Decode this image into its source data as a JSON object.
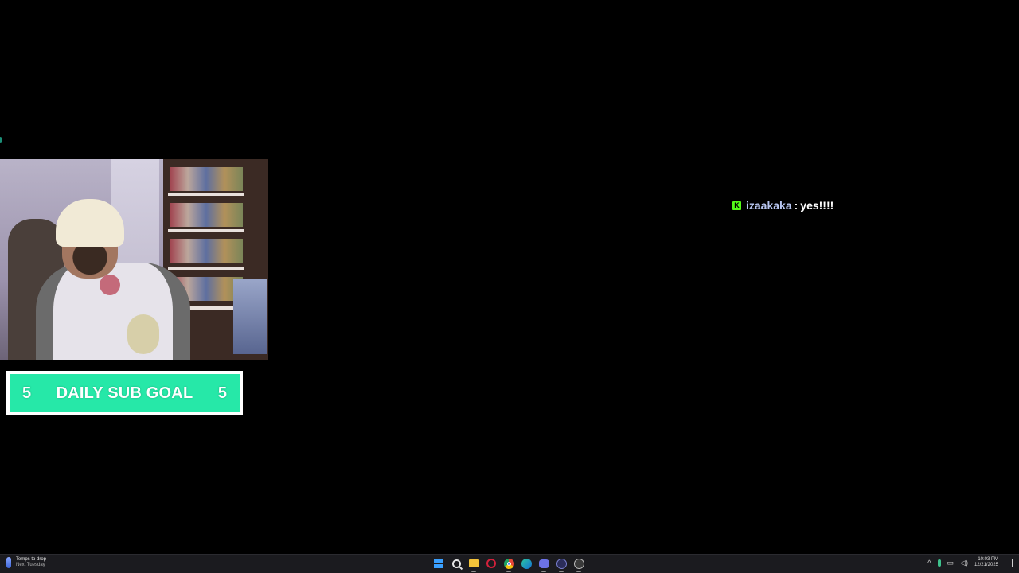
{
  "chat": {
    "username": "izaakaka",
    "separator": ":",
    "message": "yes!!!!",
    "platform_badge": "K"
  },
  "sub_goal": {
    "current": "5",
    "title": "DAILY SUB GOAL",
    "target": "5"
  },
  "taskbar": {
    "weather_line1": "Temps to drop",
    "weather_line2": "Next Tuesday",
    "apps": [
      "start-icon",
      "search-icon",
      "file-explorer-icon",
      "opera-icon",
      "chrome-icon",
      "edge-icon",
      "discord-icon",
      "app-icon",
      "obs-icon"
    ],
    "tray": {
      "chevron": "^",
      "time": "10:03 PM",
      "date": "12/21/2025"
    }
  },
  "colors": {
    "goal_fill": "#26e8a8",
    "kick_green": "#53fc18",
    "username": "#b8c6f0"
  }
}
